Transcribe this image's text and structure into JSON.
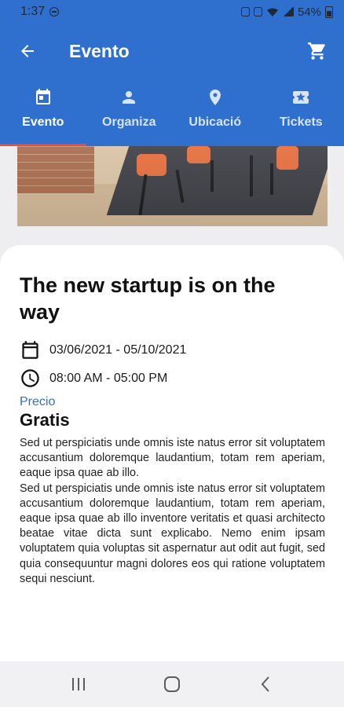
{
  "status_bar": {
    "time": "1:37",
    "battery": "54%",
    "icons": [
      "do-not-disturb-icon",
      "alarm-icon",
      "wifi-icon",
      "signal-icon",
      "battery-icon"
    ]
  },
  "app_bar": {
    "title": "Evento",
    "back_icon": "arrow-left-icon",
    "cart_icon": "cart-icon"
  },
  "tabs": [
    {
      "label": "Evento",
      "icon": "calendar-icon",
      "active": true
    },
    {
      "label": "Organiza",
      "icon": "person-icon",
      "active": false
    },
    {
      "label": "Ubicació",
      "icon": "location-pin-icon",
      "active": false
    },
    {
      "label": "Tickets",
      "icon": "ticket-icon",
      "active": false
    }
  ],
  "event": {
    "title": "The new startup is on the way",
    "dates": "03/06/2021 - 05/10/2021",
    "times": "08:00 AM - 05:00 PM",
    "price_label": "Precio",
    "price_value": "Gratis",
    "description": [
      "Sed ut perspiciatis unde omnis iste natus error sit voluptatem accusantium doloremque laudantium, totam rem aperiam, eaque ipsa quae ab illo.",
      "Sed ut perspiciatis unde omnis iste natus error sit voluptatem accusantium doloremque laudantium, totam rem aperiam, eaque ipsa quae ab illo inventore veritatis et quasi architecto beatae vitae dicta sunt explicabo. Nemo enim ipsam voluptatem quia voluptas sit aspernatur aut odit aut fugit, sed quia consequuntur magni dolores eos qui ratione voluptatem sequi nesciunt."
    ]
  },
  "colors": {
    "primary": "#2f6fce",
    "accent": "#e74c3c",
    "price_label": "#2f6fce"
  },
  "nav_bar": {
    "buttons": [
      "recent-apps-icon",
      "home-icon",
      "back-icon"
    ]
  }
}
